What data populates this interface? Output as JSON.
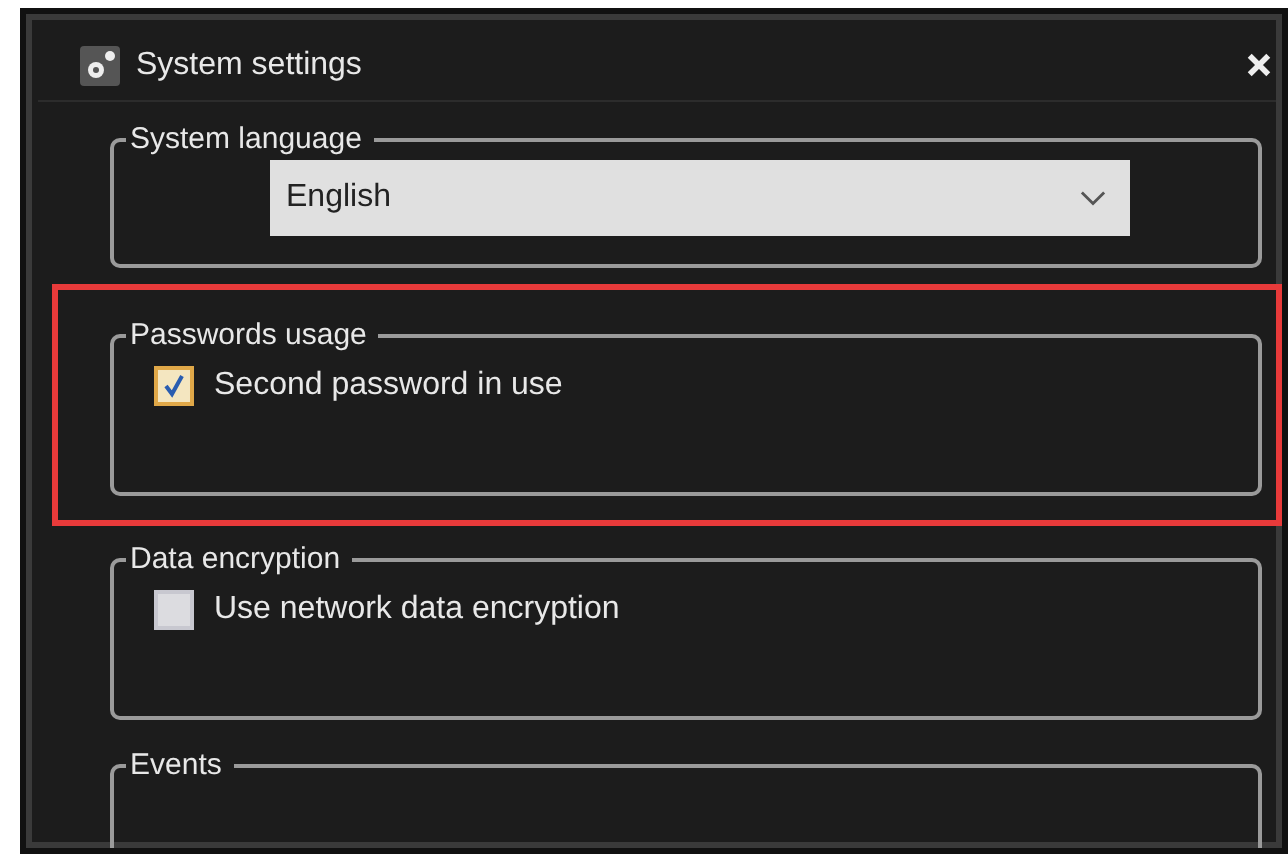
{
  "window": {
    "title": "System settings"
  },
  "groups": [
    {
      "kind": "dropdown",
      "title": "System language",
      "value": "English",
      "highlighted": false
    },
    {
      "kind": "checkbox",
      "title": "Passwords usage",
      "label": "Second password in use",
      "checked": true,
      "highlighted": true
    },
    {
      "kind": "checkbox",
      "title": "Data encryption",
      "label": "Use network data encryption",
      "checked": false,
      "highlighted": false
    },
    {
      "kind": "empty",
      "title": "Events",
      "highlighted": false
    }
  ]
}
